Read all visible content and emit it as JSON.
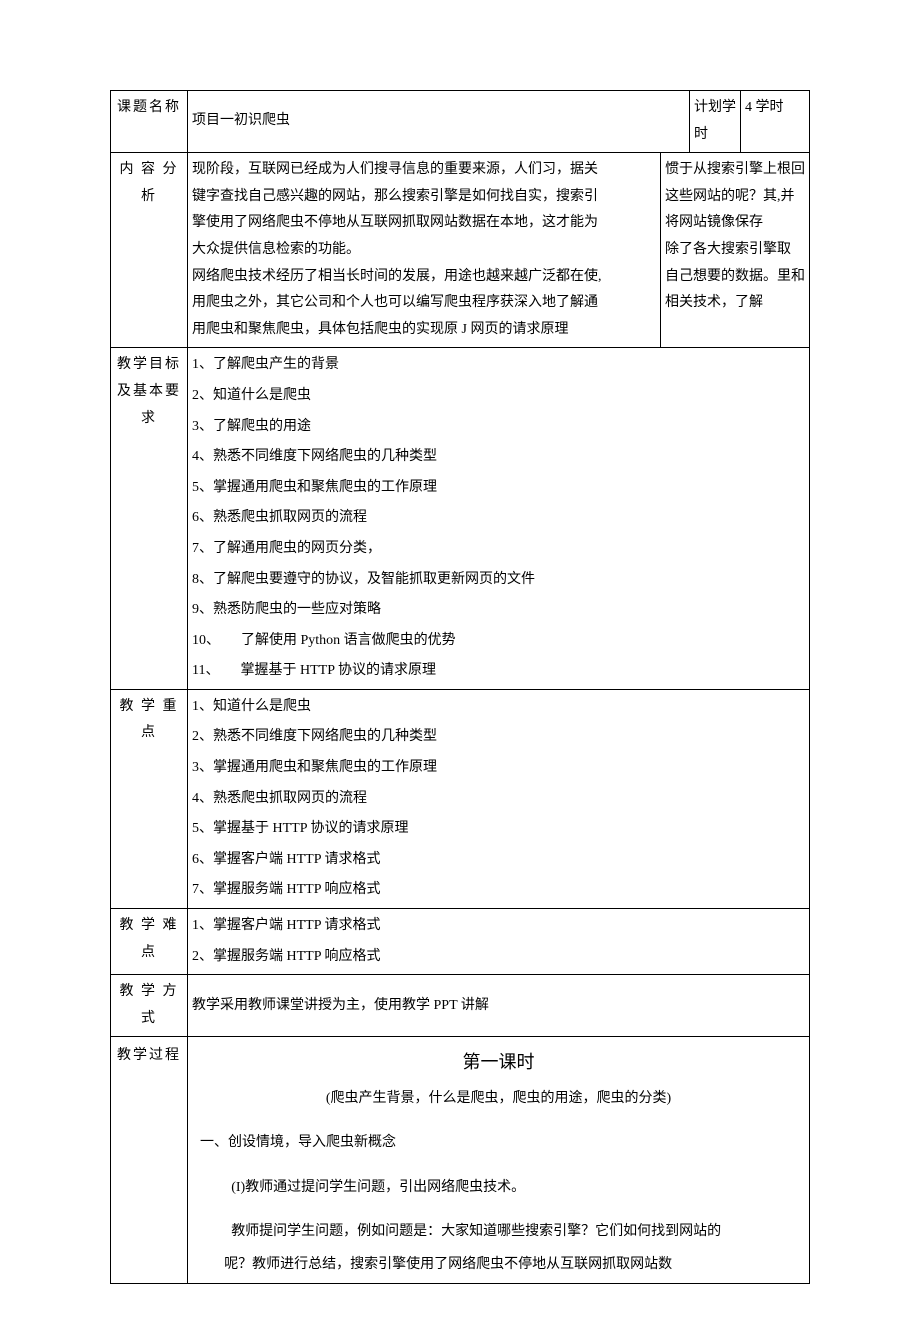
{
  "row1": {
    "label": "课题名称",
    "title": "项目一初识爬虫",
    "plan_label": "计划学时",
    "plan_value": "4 学时"
  },
  "content_analysis": {
    "label": "内 容 分析",
    "left_lines": [
      "现阶段，互联网已经成为人们搜寻信息的重要来源，人们习，据关",
      "键字查找自己感兴趣的网站，那么搜索引擎是如何找自实，搜索引",
      "擎使用了网络爬虫不停地从互联网抓取网站数据在本地，这才能为",
      "大众提供信息检索的功能。",
      "网络爬虫技术经历了相当长时间的发展，用途也越来越广泛都在使,",
      "用爬虫之外，其它公司和个人也可以编写爬虫程序获深入地了解通",
      "用爬虫和聚焦爬虫，具体包括爬虫的实现原 J 网页的请求原理"
    ],
    "right_lines": [
      "惯于从搜索引擎上根回",
      "这些网站的呢？其,并",
      "将网站镜像保存",
      "",
      "除了各大搜索引擎取",
      "自己想要的数据。里和",
      "相关技术，了解"
    ]
  },
  "objectives": {
    "label": "教学目标及基本要求",
    "items": [
      "1、了解爬虫产生的背景",
      "2、知道什么是爬虫",
      "3、了解爬虫的用途",
      "4、熟悉不同维度下网络爬虫的几种类型",
      "5、掌握通用爬虫和聚焦爬虫的工作原理",
      "6、熟悉爬虫抓取网页的流程",
      "7、了解通用爬虫的网页分类，",
      "8、了解爬虫要遵守的协议，及智能抓取更新网页的文件",
      "9、熟悉防爬虫的一些应对策略",
      "10、　　了解使用 Python 语言做爬虫的优势",
      "11、　　掌握基于 HTTP 协议的请求原理"
    ]
  },
  "key_points": {
    "label": "教 学 重点",
    "items": [
      "1、知道什么是爬虫",
      "2、熟悉不同维度下网络爬虫的几种类型",
      "3、掌握通用爬虫和聚焦爬虫的工作原理",
      "4、熟悉爬虫抓取网页的流程",
      "5、掌握基于 HTTP 协议的请求原理",
      "6、掌握客户端 HTTP 请求格式",
      "7、掌握服务端 HTTP 响应格式"
    ]
  },
  "difficulties": {
    "label": "教 学 难点",
    "items": [
      "1、掌握客户端 HTTP 请求格式",
      "2、掌握服务端 HTTP 响应格式"
    ]
  },
  "method": {
    "label": "教 学 方式",
    "text": "教学采用教师课堂讲授为主，使用教学 PPT 讲解"
  },
  "process": {
    "label": "教学过程",
    "lesson_title": "第一课时",
    "lesson_sub": "(爬虫产生背景，什么是爬虫，爬虫的用途，爬虫的分类)",
    "section1": "一、创设情境，导入爬虫新概念",
    "p1": "(I)教师通过提问学生问题，引出网络爬虫技术。",
    "p2": "教师提问学生问题，例如问题是：大家知道哪些搜索引擎？它们如何找到网站的",
    "p3": "呢？教师进行总结，搜索引擎使用了网络爬虫不停地从互联网抓取网站数"
  }
}
